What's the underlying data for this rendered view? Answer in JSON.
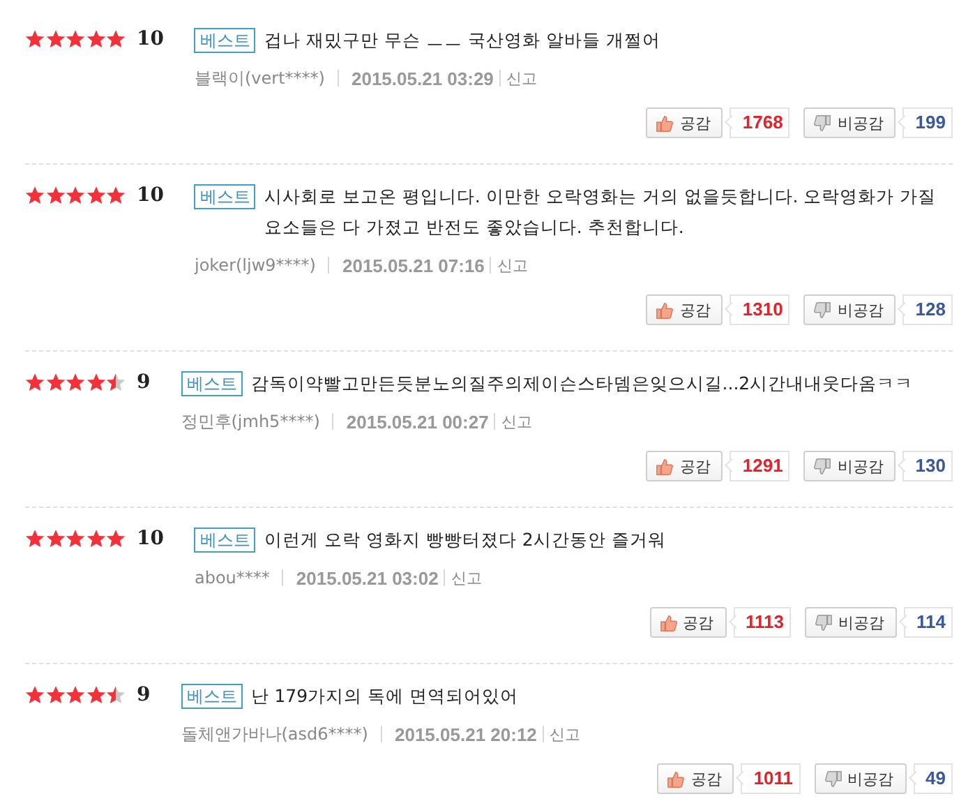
{
  "reviews": [
    {
      "stars": 5,
      "score": "10",
      "badge": "베스트",
      "text": "겁나 재밌구만 무슨 ㅡㅡ 국산영화 알바들 개쩔어",
      "author": "블랙이(vert****)",
      "date": "2015.05.21 03:29",
      "report": "신고",
      "like_label": "공감",
      "like_count": "1768",
      "dislike_label": "비공감",
      "dislike_count": "199"
    },
    {
      "stars": 5,
      "score": "10",
      "badge": "베스트",
      "text": "시사회로 보고온 평입니다. 이만한 오락영화는 거의 없을듯합니다. 오락영화가 가질 요소들은 다 가졌고 반전도 좋았습니다. 추천합니다.",
      "author": "joker(ljw9****)",
      "date": "2015.05.21 07:16",
      "report": "신고",
      "like_label": "공감",
      "like_count": "1310",
      "dislike_label": "비공감",
      "dislike_count": "128"
    },
    {
      "stars": 4.5,
      "score": "9",
      "badge": "베스트",
      "text": "감독이약빨고만든듯분노의질주의제이슨스타뎀은잊으시길...2시간내내웃다옴ㅋㅋ",
      "author": "정민후(jmh5****)",
      "date": "2015.05.21 00:27",
      "report": "신고",
      "like_label": "공감",
      "like_count": "1291",
      "dislike_label": "비공감",
      "dislike_count": "130"
    },
    {
      "stars": 5,
      "score": "10",
      "badge": "베스트",
      "text": "이런게 오락 영화지 빵빵터졌다 2시간동안 즐거워",
      "author": "abou****",
      "date": "2015.05.21 03:02",
      "report": "신고",
      "like_label": "공감",
      "like_count": "1113",
      "dislike_label": "비공감",
      "dislike_count": "114"
    },
    {
      "stars": 4.5,
      "score": "9",
      "badge": "베스트",
      "text": "난 179가지의 독에 면역되어있어",
      "author": "돌체앤가바나(asd6****)",
      "date": "2015.05.21 20:12",
      "report": "신고",
      "like_label": "공감",
      "like_count": "1011",
      "dislike_label": "비공감",
      "dislike_count": "49"
    }
  ]
}
